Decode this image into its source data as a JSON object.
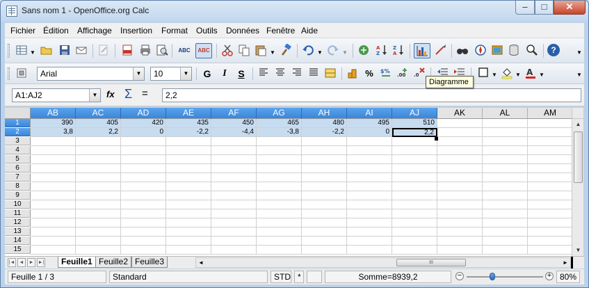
{
  "window": {
    "title": "Sans nom 1 - OpenOffice.org Calc",
    "controls": {
      "minimize": "–",
      "maximize": "□",
      "close": "✕"
    }
  },
  "menu": [
    "Fichier",
    "Édition",
    "Affichage",
    "Insertion",
    "Format",
    "Outils",
    "Données",
    "Fenêtre",
    "Aide"
  ],
  "toolbar_standard": {
    "icons": [
      "new-document",
      "open-folder",
      "save",
      "email",
      "edit-file",
      "export-pdf",
      "print",
      "print-preview",
      "spellcheck",
      "autospellcheck",
      "cut",
      "copy",
      "paste",
      "clone-formatting",
      "undo",
      "redo",
      "hyperlink",
      "sort-ascending",
      "sort-descending",
      "insert-chart",
      "show-draw-functions",
      "find-replace",
      "navigator",
      "gallery",
      "data-sources",
      "zoom",
      "help"
    ],
    "glyphs": {
      "spellcheck": "ABC",
      "autospellcheck": "ABC",
      "help": "?"
    }
  },
  "toolbar_formatting": {
    "font_name": "Arial",
    "font_size": "10",
    "bold": "G",
    "italic": "I",
    "underline": "S",
    "percent": "%",
    "icons": [
      "align-left",
      "align-center",
      "align-right",
      "justify",
      "merge-cells",
      "currency-format",
      "percent-format",
      "standard-format",
      "add-decimal",
      "delete-decimal",
      "decrease-indent",
      "increase-indent",
      "borders",
      "background-color",
      "font-color"
    ]
  },
  "tooltip": "Diagramme",
  "formula_bar": {
    "name_box": "A1:AJ2",
    "fx": "fx",
    "sum": "Σ",
    "equals": "=",
    "content": "2,2"
  },
  "columns": [
    {
      "label": "AB",
      "selected": true
    },
    {
      "label": "AC",
      "selected": true
    },
    {
      "label": "AD",
      "selected": true
    },
    {
      "label": "AE",
      "selected": true
    },
    {
      "label": "AF",
      "selected": true
    },
    {
      "label": "AG",
      "selected": true
    },
    {
      "label": "AH",
      "selected": true
    },
    {
      "label": "AI",
      "selected": true
    },
    {
      "label": "AJ",
      "selected": true
    },
    {
      "label": "AK",
      "selected": false
    },
    {
      "label": "AL",
      "selected": false
    },
    {
      "label": "AM",
      "selected": false
    }
  ],
  "rows": [
    "1",
    "2",
    "3",
    "4",
    "5",
    "6",
    "7",
    "8",
    "9",
    "10",
    "11",
    "12",
    "13",
    "14",
    "15"
  ],
  "cells": [
    [
      "390",
      "405",
      "420",
      "435",
      "450",
      "465",
      "480",
      "495",
      "510"
    ],
    [
      "3,8",
      "2,2",
      "0",
      "-2,2",
      "-4,4",
      "-3,8",
      "-2,2",
      "0",
      "2,2"
    ]
  ],
  "sheet_tabs": [
    {
      "label": "Feuille1",
      "active": true
    },
    {
      "label": "Feuille2",
      "active": false
    },
    {
      "label": "Feuille3",
      "active": false
    }
  ],
  "scroll_glyphs": {
    "up": "▲",
    "down": "▼",
    "left": "◄",
    "right": "►",
    "thumb": "III"
  },
  "status_bar": {
    "sheet": "Feuille 1 / 3",
    "style": "Standard",
    "mode": "STD",
    "modified": "*",
    "sum": "Somme=8939,2",
    "zoom_minus": "−",
    "zoom_plus": "+",
    "zoom": "80%"
  },
  "colors": {
    "selection_header": "#3b86d8",
    "selection_cell": "#c8dcf0",
    "titlebar": "#c2d7ee",
    "close_button": "#c8442c"
  }
}
